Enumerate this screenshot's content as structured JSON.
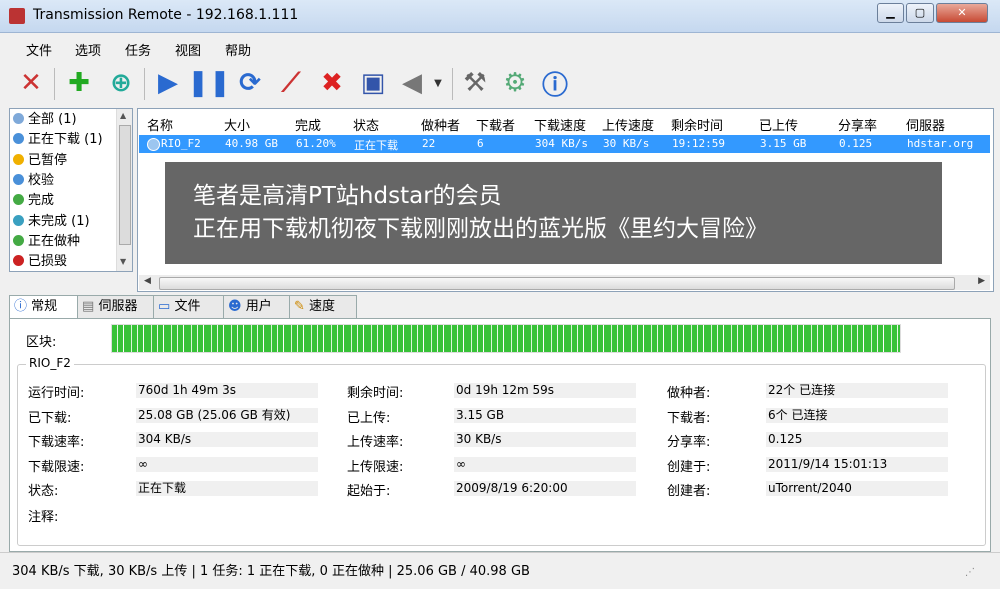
{
  "window": {
    "title": "Transmission Remote - 192.168.1.111"
  },
  "menu": [
    "文件",
    "选项",
    "任务",
    "视图",
    "帮助"
  ],
  "toolbar": {
    "icons": [
      "disconnect-icon",
      "add-icon",
      "add-url-icon",
      "start-icon",
      "pause-icon",
      "refresh-icon",
      "tools-icon",
      "remove-icon",
      "trash-icon",
      "speaker-icon",
      "dropdown-icon",
      "settings-icon",
      "connection-settings-icon",
      "about-icon"
    ]
  },
  "sidebar": {
    "items": [
      {
        "label": "全部 (1)",
        "color": "#7fa9d9"
      },
      {
        "label": "正在下载 (1)",
        "color": "#4a90d9"
      },
      {
        "label": "已暂停",
        "color": "#f0b000"
      },
      {
        "label": "校验",
        "color": "#4a90d9"
      },
      {
        "label": "完成",
        "color": "#44aa44"
      },
      {
        "label": "未完成 (1)",
        "color": "#3aa0c0"
      },
      {
        "label": "正在做种",
        "color": "#44aa44"
      },
      {
        "label": "已损毁",
        "color": "#cc2222"
      }
    ]
  },
  "torrents": {
    "columns": [
      "名称",
      "大小",
      "完成",
      "状态",
      "做种者",
      "下载者",
      "下载速度",
      "上传速度",
      "剩余时间",
      "已上传",
      "分享率",
      "伺服器"
    ],
    "rows": [
      [
        "RIO_F2",
        "40.98 GB",
        "61.20%",
        "正在下载",
        "22",
        "6",
        "304 KB/s",
        "30 KB/s",
        "19:12:59",
        "3.15 GB",
        "0.125",
        "hdstar.org"
      ]
    ]
  },
  "overlay": {
    "line1": "笔者是高清PT站hdstar的会员",
    "line2": "正在用下载机彻夜下载刚刚放出的蓝光版《里约大冒险》"
  },
  "tabs": [
    "常规",
    "伺服器",
    "文件",
    "用户",
    "速度"
  ],
  "details": {
    "pieces_label": "区块:",
    "group_title": "RIO_F2",
    "fields": [
      {
        "label": "运行时间:",
        "value": "760d 1h 49m 3s"
      },
      {
        "label": "剩余时间:",
        "value": "0d 19h 12m 59s"
      },
      {
        "label": "做种者:",
        "value": "22个 已连接"
      },
      {
        "label": "已下载:",
        "value": "25.08 GB (25.06 GB 有效)"
      },
      {
        "label": "已上传:",
        "value": "3.15 GB"
      },
      {
        "label": "下载者:",
        "value": "6个 已连接"
      },
      {
        "label": "下载速率:",
        "value": "304 KB/s"
      },
      {
        "label": "上传速率:",
        "value": "30 KB/s"
      },
      {
        "label": "分享率:",
        "value": "0.125"
      },
      {
        "label": "下载限速:",
        "value": "∞"
      },
      {
        "label": "上传限速:",
        "value": "∞"
      },
      {
        "label": "创建于:",
        "value": "2011/9/14 15:01:13"
      },
      {
        "label": "状态:",
        "value": "正在下载"
      },
      {
        "label": "起始于:",
        "value": "2009/8/19 6:20:00"
      },
      {
        "label": "创建者:",
        "value": "uTorrent/2040"
      }
    ],
    "comment_label": "注释:"
  },
  "statusbar": {
    "text": "304 KB/s 下载, 30 KB/s 上传 | 1 任务: 1 正在下载, 0 正在做种 | 25.06 GB / 40.98 GB"
  }
}
